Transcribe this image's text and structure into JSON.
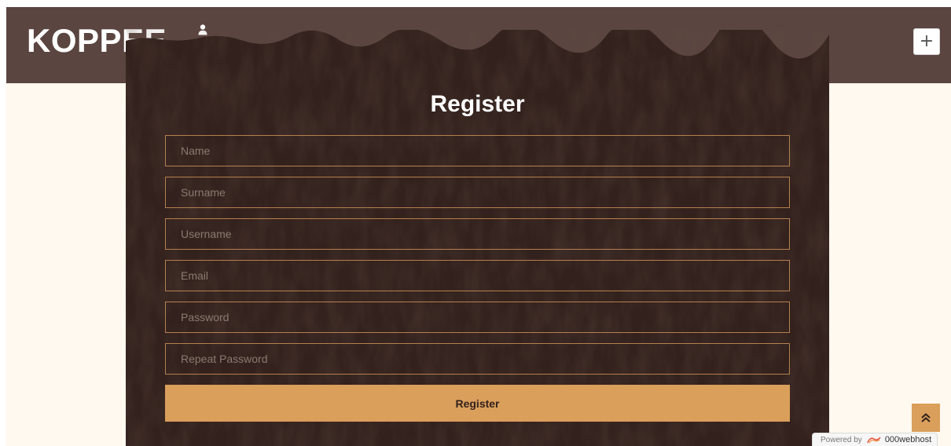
{
  "header": {
    "brand": "KOPPEE",
    "icons": [
      "user-icon",
      "sign-out-icon"
    ],
    "toggler_icon": "+"
  },
  "form": {
    "title": "Register",
    "fields": [
      {
        "name": "name",
        "placeholder": "Name",
        "value": ""
      },
      {
        "name": "surname",
        "placeholder": "Surname",
        "value": ""
      },
      {
        "name": "username",
        "placeholder": "Username",
        "value": ""
      },
      {
        "name": "email",
        "placeholder": "Email",
        "value": ""
      },
      {
        "name": "password",
        "placeholder": "Password",
        "value": ""
      },
      {
        "name": "repeat_password",
        "placeholder": "Repeat Password",
        "value": ""
      }
    ],
    "submit_label": "Register"
  },
  "footer": {
    "back_to_top_icon": "double-chevron-up-icon",
    "powered_by_label": "Powered by",
    "powered_by_brand": "000webhost"
  },
  "colors": {
    "topbar": "#5b4540",
    "page_background": "#fff9f0",
    "panel_background": "#33211d",
    "accent": "#da9f5b",
    "field_border": "#b5804f"
  }
}
